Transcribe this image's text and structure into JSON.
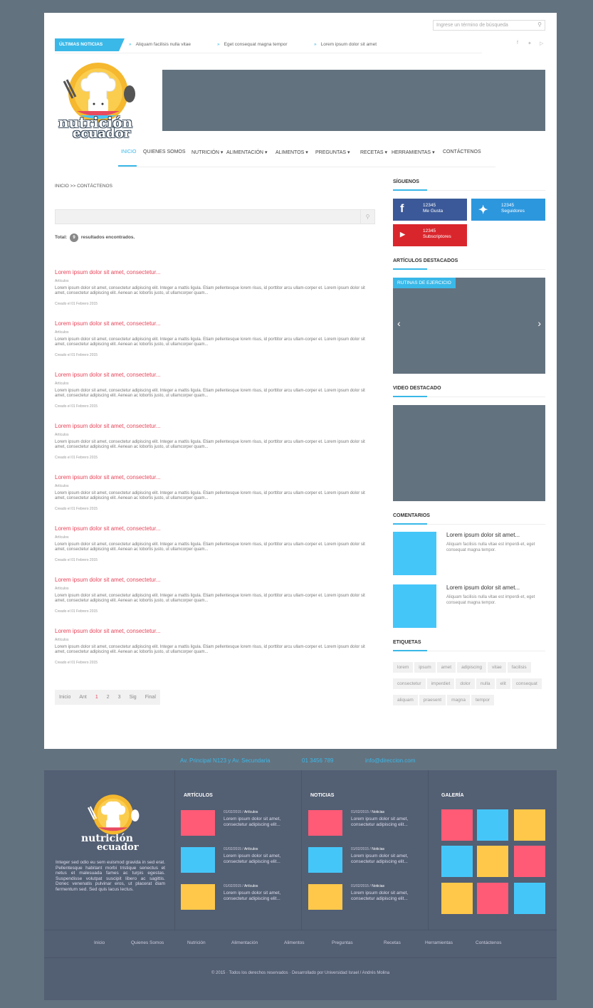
{
  "header": {
    "search_placeholder": "Ingrese un término de búsqueda",
    "ticker_label": "ÚLTIMAS NOTICIAS",
    "ticker_items": [
      "Aliquam facilisis nulla vitae",
      "Eget consequat magna tempor",
      "Lorem ipsum dolor sit amet"
    ],
    "social": [
      "f",
      "t",
      "yt"
    ]
  },
  "logo": {
    "line1": "nutrición",
    "line2": "ecuador"
  },
  "nav": [
    {
      "label": "INICIO"
    },
    {
      "label": "QUIENES SOMOS"
    },
    {
      "label": "NUTRICIÓN"
    },
    {
      "label": "ALIMENTACIÓN"
    },
    {
      "label": "ALIMENTOS"
    },
    {
      "label": "PREGUNTAS"
    },
    {
      "label": "RECETAS"
    },
    {
      "label": "HERRAMIENTAS"
    },
    {
      "label": "CONTÁCTENOS"
    }
  ],
  "breadcrumb": "INICIO >> CONTÁCTENOS",
  "results": {
    "prefix": "Total:",
    "count": "9",
    "suffix": "resultados encontrados."
  },
  "articles": [
    {
      "title": "Lorem ipsum dolor sit amet, consectetur...",
      "category": "Artículos",
      "desc": "Lorem ipsum dolor sit amet, consectetur adipiscing elit. Integer a mattis ligula. Etiam pellentesque lorem risus, id porttitor arcu ullam-corper et. Lorem ipsum dolor sit amet, consectetur adipiscing elit. Aenean ac lobortis justo, ut ullamcorper quam...",
      "date": "Creado el 01 Febrero 2015"
    },
    {
      "title": "Lorem ipsum dolor sit amet, consectetur...",
      "category": "Artículos",
      "desc": "Lorem ipsum dolor sit amet, consectetur adipiscing elit. Integer a mattis ligula. Etiam pellentesque lorem risus, id porttitor arcu ullam-corper et. Lorem ipsum dolor sit amet, consectetur adipiscing elit. Aenean ac lobortis justo, ut ullamcorper quam...",
      "date": "Creado el 01 Febrero 2015"
    },
    {
      "title": "Lorem ipsum dolor sit amet, consectetur...",
      "category": "Artículos",
      "desc": "Lorem ipsum dolor sit amet, consectetur adipiscing elit. Integer a mattis ligula. Etiam pellentesque lorem risus, id porttitor arcu ullam-corper et. Lorem ipsum dolor sit amet, consectetur adipiscing elit. Aenean ac lobortis justo, ut ullamcorper quam...",
      "date": "Creado el 01 Febrero 2015"
    },
    {
      "title": "Lorem ipsum dolor sit amet, consectetur...",
      "category": "Artículos",
      "desc": "Lorem ipsum dolor sit amet, consectetur adipiscing elit. Integer a mattis ligula. Etiam pellentesque lorem risus, id porttitor arcu ullam-corper et. Lorem ipsum dolor sit amet, consectetur adipiscing elit. Aenean ac lobortis justo, ut ullamcorper quam...",
      "date": "Creado el 01 Febrero 2015"
    },
    {
      "title": "Lorem ipsum dolor sit amet, consectetur...",
      "category": "Artículos",
      "desc": "Lorem ipsum dolor sit amet, consectetur adipiscing elit. Integer a mattis ligula. Etiam pellentesque lorem risus, id porttitor arcu ullam-corper et. Lorem ipsum dolor sit amet, consectetur adipiscing elit. Aenean ac lobortis justo, ut ullamcorper quam...",
      "date": "Creado el 01 Febrero 2015"
    },
    {
      "title": "Lorem ipsum dolor sit amet, consectetur...",
      "category": "Artículos",
      "desc": "Lorem ipsum dolor sit amet, consectetur adipiscing elit. Integer a mattis ligula. Etiam pellentesque lorem risus, id porttitor arcu ullam-corper et. Lorem ipsum dolor sit amet, consectetur adipiscing elit. Aenean ac lobortis justo, ut ullamcorper quam...",
      "date": "Creado el 01 Febrero 2015"
    },
    {
      "title": "Lorem ipsum dolor sit amet, consectetur...",
      "category": "Artículos",
      "desc": "Lorem ipsum dolor sit amet, consectetur adipiscing elit. Integer a mattis ligula. Etiam pellentesque lorem risus, id porttitor arcu ullam-corper et. Lorem ipsum dolor sit amet, consectetur adipiscing elit. Aenean ac lobortis justo, ut ullamcorper quam...",
      "date": "Creado el 01 Febrero 2015"
    },
    {
      "title": "Lorem ipsum dolor sit amet, consectetur...",
      "category": "Artículos",
      "desc": "Lorem ipsum dolor sit amet, consectetur adipiscing elit. Integer a mattis ligula. Etiam pellentesque lorem risus, id porttitor arcu ullam-corper et. Lorem ipsum dolor sit amet, consectetur adipiscing elit. Aenean ac lobortis justo, ut ullamcorper quam...",
      "date": "Creado el 01 Febrero 2015"
    }
  ],
  "pager": [
    "Inicio",
    "Ant",
    "1",
    "2",
    "3",
    "Sig",
    "Final"
  ],
  "sidebar": {
    "follow_title": "SÍGUENOS",
    "facebook": {
      "count": "12345",
      "label": "Me Gusta"
    },
    "twitter": {
      "count": "12345",
      "label": "Seguidores"
    },
    "youtube": {
      "count": "12345",
      "label": "Subscriptores"
    },
    "featured_title": "ARTÍCULOS DESTACADOS",
    "featured_tag": "RUTINAS DE EJERCICIO",
    "video_title": "VIDEO DESTACADO",
    "comments_title": "COMENTARIOS",
    "comments": [
      {
        "title": "Lorem ipsum dolor sit amet...",
        "text": "Aliquam facilisis nulla vitae est imperdi-et, eget consequat magna tempor."
      },
      {
        "title": "Lorem ipsum dolor sit amet...",
        "text": "Aliquam facilisis nulla vitae est imperdi-et, eget consequat magna tempor."
      }
    ],
    "tags_title": "ETIQUETAS",
    "tags": [
      "lorem",
      "ipsum",
      "amet",
      "adipiscing",
      "vitae",
      "facilisis",
      "consectetur",
      "imperdiet",
      "dolor",
      "nulla",
      "elit",
      "consequat",
      "aliquam",
      "praesent",
      "magna",
      "tempor"
    ]
  },
  "contact": {
    "address": "Av. Principal N123 y Av. Secundaria",
    "phone": "01 3456 789",
    "email": "info@direccion.com"
  },
  "footer": {
    "description": "Integer sed odio eu sem euismod gravida in sed erat. Pellentesque habitant morbi tristique senectus et netus et malesuada fames ac turpis egestas. Suspendisse volutpat suscipit libero ac sagittis. Donec venenatis pulvinar eros, ut placerat diam fermentum sed. Sed quis lacus lectus.",
    "articles_title": "ARTÍCULOS",
    "news_title": "NOTICIAS",
    "gallery_title": "GALERÍA",
    "articles": [
      {
        "date": "01/02/2015 /",
        "cat": "Artículos",
        "text": "Lorem ipsum dolor sit amet, consectetur adipiscing elit..."
      },
      {
        "date": "01/02/2015 /",
        "cat": "Artículos",
        "text": "Lorem ipsum dolor sit amet, consectetur adipiscing elit..."
      },
      {
        "date": "01/02/2015 /",
        "cat": "Artículos",
        "text": "Lorem ipsum dolor sit amet, consectetur adipiscing elit..."
      }
    ],
    "news": [
      {
        "date": "01/02/2015 /",
        "cat": "Noticias",
        "text": "Lorem ipsum dolor sit amet, consectetur adipiscing elit..."
      },
      {
        "date": "01/02/2015 /",
        "cat": "Noticias",
        "text": "Lorem ipsum dolor sit amet, consectetur adipiscing elit..."
      },
      {
        "date": "01/02/2015 /",
        "cat": "Noticias",
        "text": "Lorem ipsum dolor sit amet, consectetur adipiscing elit..."
      }
    ],
    "nav": [
      "Inicio",
      "Quienes Somos",
      "Nutrición",
      "Alimentación",
      "Alimentos",
      "Preguntas",
      "Recetas",
      "Herramientas",
      "Contáctenos"
    ],
    "copyright": "© 2015 · Todos los derechos reservados · Desarrollado por Universidad Israel / Andrés Molina"
  },
  "colors": {
    "accent": "#3ab8e8",
    "pink": "#ff5b76",
    "blue": "#45c6f9",
    "yellow": "#ffc84a",
    "bg": "#63727f",
    "footer": "#535f73"
  }
}
